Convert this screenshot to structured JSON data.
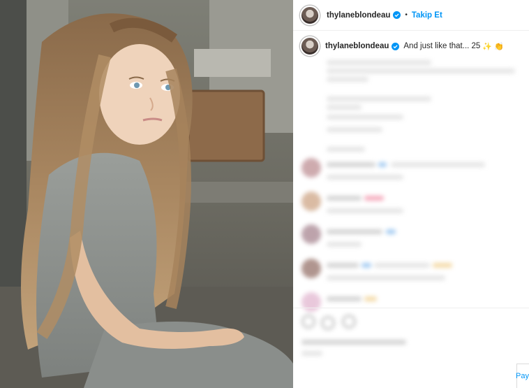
{
  "post": {
    "username": "thylaneblondeau",
    "follow_separator": "•",
    "follow_label": "Takip Et",
    "caption_text": "And just like that... 25",
    "caption_emoji_1": "✨",
    "caption_emoji_2": "👏"
  },
  "icons": {
    "verified": "verified-badge-icon",
    "avatar": "profile-avatar"
  },
  "colors": {
    "accent": "#0095f6",
    "text": "#262626",
    "divider": "#efefef"
  },
  "footer": {
    "post_label": "Pay"
  }
}
